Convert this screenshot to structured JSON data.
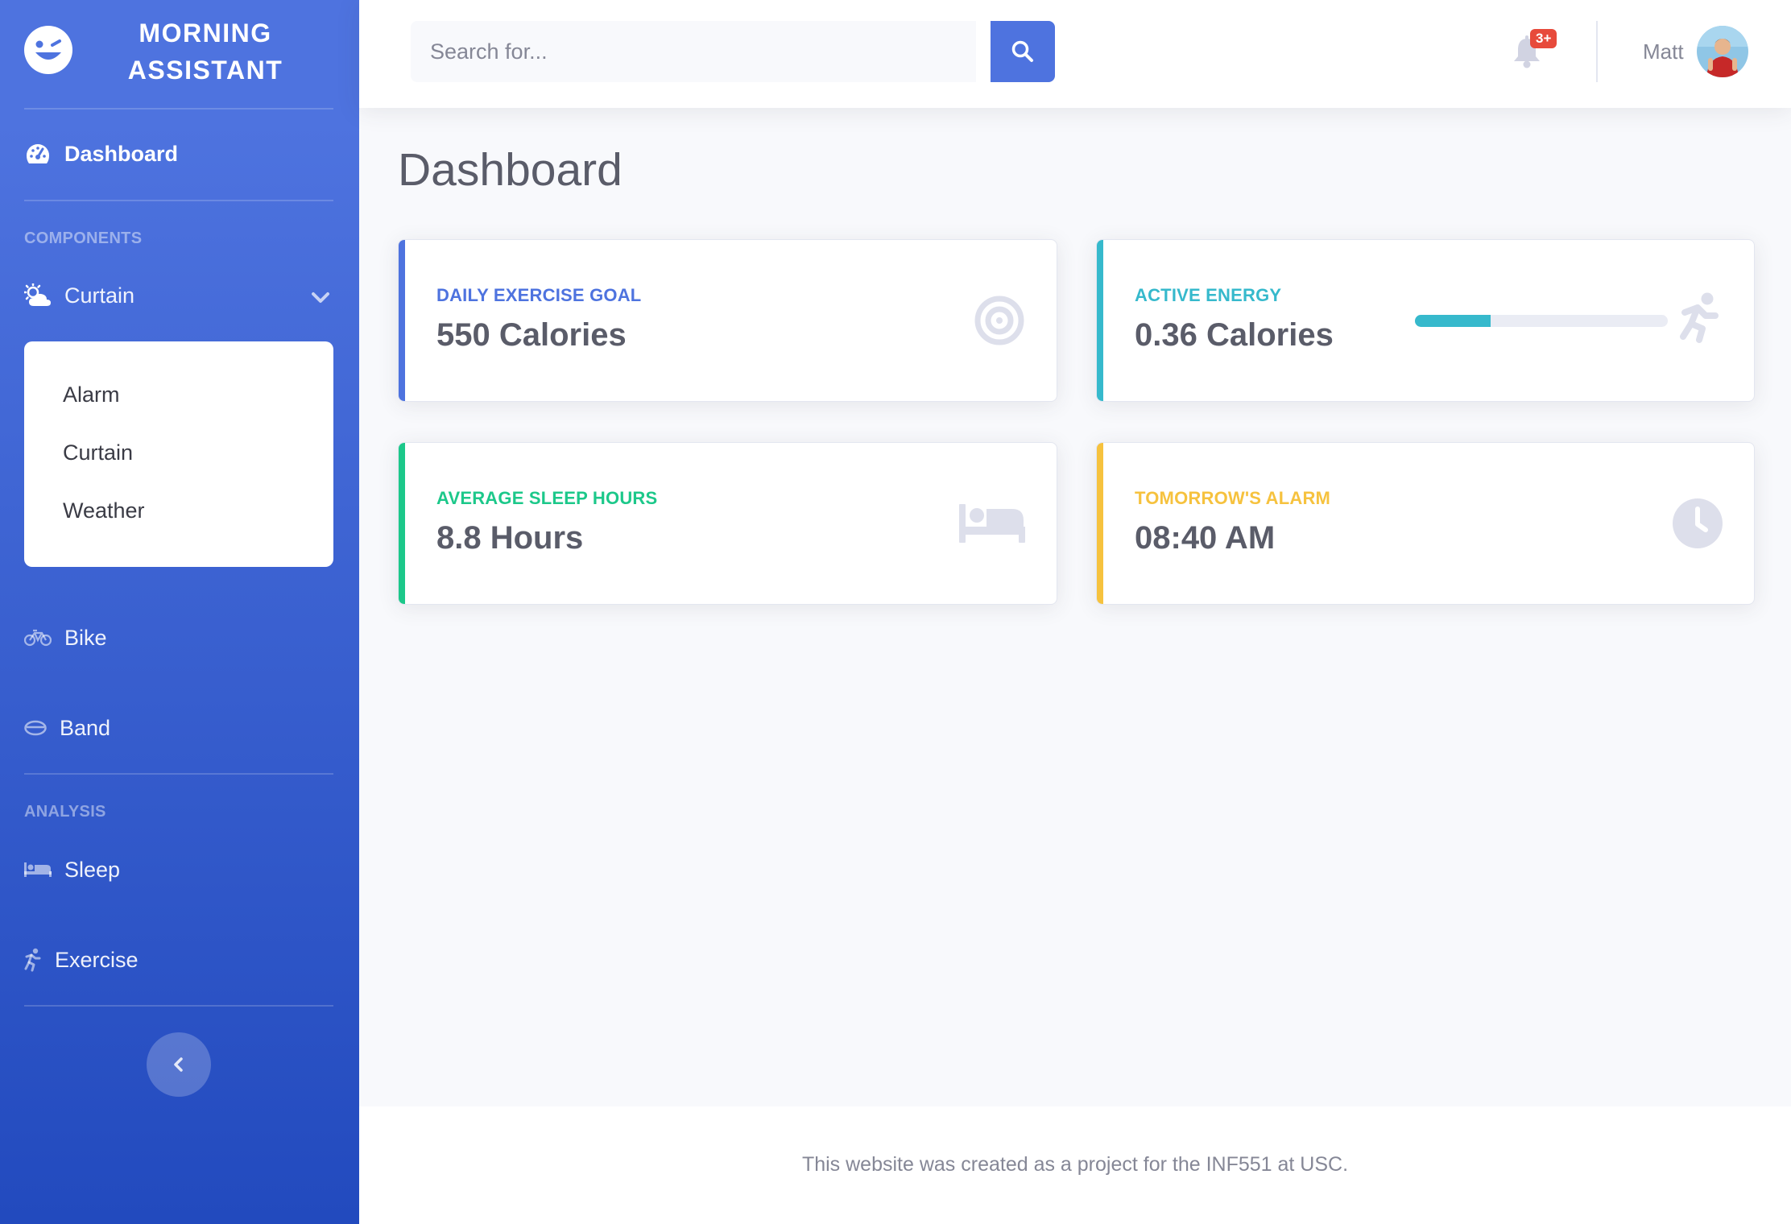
{
  "brand": {
    "line1": "MORNING",
    "line2": "ASSISTANT"
  },
  "sidebar": {
    "dashboard_label": "Dashboard",
    "heading_components": "COMPONENTS",
    "curtain_label": "Curtain",
    "submenu": [
      "Alarm",
      "Curtain",
      "Weather"
    ],
    "bike_label": "Bike",
    "band_label": "Band",
    "heading_analysis": "ANALYSIS",
    "sleep_label": "Sleep",
    "exercise_label": "Exercise"
  },
  "topbar": {
    "search_placeholder": "Search for...",
    "alerts_badge": "3+",
    "user_name": "Matt"
  },
  "page": {
    "title": "Dashboard"
  },
  "cards": [
    {
      "title": "Daily Exercise Goal",
      "value": "550 Calories",
      "color": "#4e73df",
      "icon": "bullseye-icon"
    },
    {
      "title": "Active Energy",
      "value": "0.36 Calories",
      "color": "#36b9cc",
      "icon": "running-icon",
      "progress_percent": 30
    },
    {
      "title": "Average Sleep Hours",
      "value": "8.8 Hours",
      "color": "#1cc88a",
      "icon": "bed-icon"
    },
    {
      "title": "Tomorrow's Alarm",
      "value": "08:40 AM",
      "color": "#f6c23e",
      "icon": "clock-icon"
    }
  ],
  "footer": {
    "text": "This website was created as a project for the INF551 at USC."
  }
}
